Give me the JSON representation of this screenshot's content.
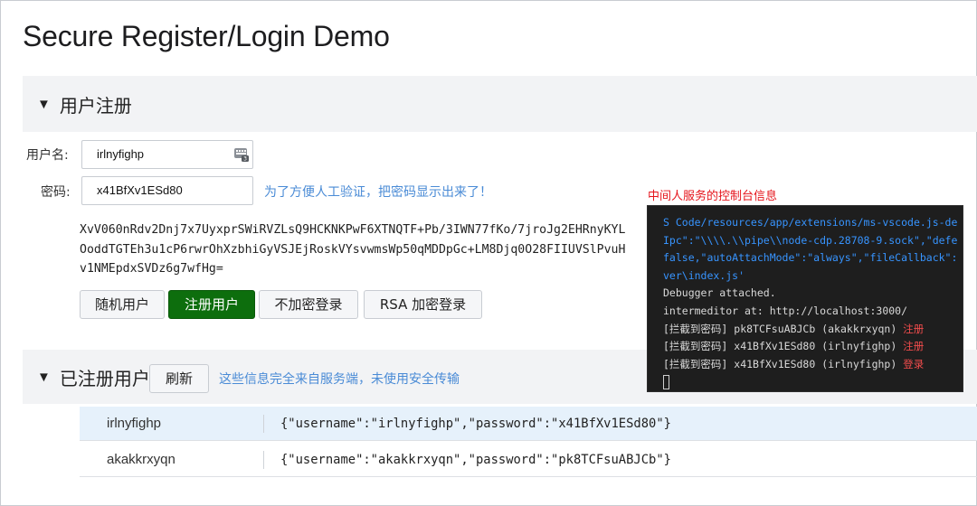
{
  "page": {
    "title": "Secure Register/Login Demo"
  },
  "register": {
    "section_title": "用户注册",
    "username_label": "用户名:",
    "username_value": "irlnyfighp",
    "password_label": "密码:",
    "password_value": "x41BfXv1ESd80",
    "password_hint": "为了方便人工验证，把密码显示出来了！",
    "cipher_text": "XvV060nRdv2Dnj7x7UyxprSWiRVZLsQ9HCKNKPwF6XTNQTF+Pb/3IWN77fKo/7jroJg2EHRnyKYLOoddTGTEh3u1cP6rwrOhXzbhiGyVSJEjRoskVYsvwmsWp50qMDDpGc+LM8Djq0O28FIIUVSlPvuHv1NMEpdxSVDz6g7wfHg=",
    "buttons": {
      "random": "随机用户",
      "register": "注册用户",
      "plain_login": "不加密登录",
      "rsa_login": "RSA 加密登录"
    }
  },
  "registered": {
    "section_title": "已注册用户",
    "refresh_label": "刷新",
    "hint": "这些信息完全来自服务端，未使用安全传输",
    "rows": [
      {
        "name": "irlnyfighp",
        "json": "{\"username\":\"irlnyfighp\",\"password\":\"x41BfXv1ESd80\"}"
      },
      {
        "name": "akakkrxyqn",
        "json": "{\"username\":\"akakkrxyqn\",\"password\":\"pk8TCFsuABJCb\"}"
      }
    ]
  },
  "console": {
    "title": "中间人服务的控制台信息",
    "lines": [
      {
        "text": "S Code/resources/app/extensions/ms-vscode.js-de",
        "tag": ""
      },
      {
        "text": "Ipc\":\"\\\\\\\\.\\\\pipe\\\\node-cdp.28708-9.sock\",\"defe",
        "tag": ""
      },
      {
        "text": "false,\"autoAttachMode\":\"always\",\"fileCallback\":",
        "tag": ""
      },
      {
        "text": "ver\\index.js'",
        "tag": ""
      },
      {
        "text": "Debugger attached.",
        "tag": ""
      },
      {
        "text": "intermeditor at: http://localhost:3000/",
        "tag": ""
      },
      {
        "text": "[拦截到密码] pk8TCFsuABJCb (akakkrxyqn)",
        "tag": "注册"
      },
      {
        "text": "[拦截到密码] x41BfXv1ESd80 (irlnyfighp)",
        "tag": "注册"
      },
      {
        "text": "[拦截到密码] x41BfXv1ESd80 (irlnyfighp)",
        "tag": "登录"
      }
    ]
  },
  "icons": {
    "keyboard": "keyboard-badge-icon",
    "expand": "caret-down-icon"
  },
  "colors": {
    "register_button": "#0d6e0d",
    "hint": "#4a8bd6",
    "console_bg": "#1e1e1e",
    "console_accent": "#3794ff",
    "alert": "#e5141b"
  }
}
